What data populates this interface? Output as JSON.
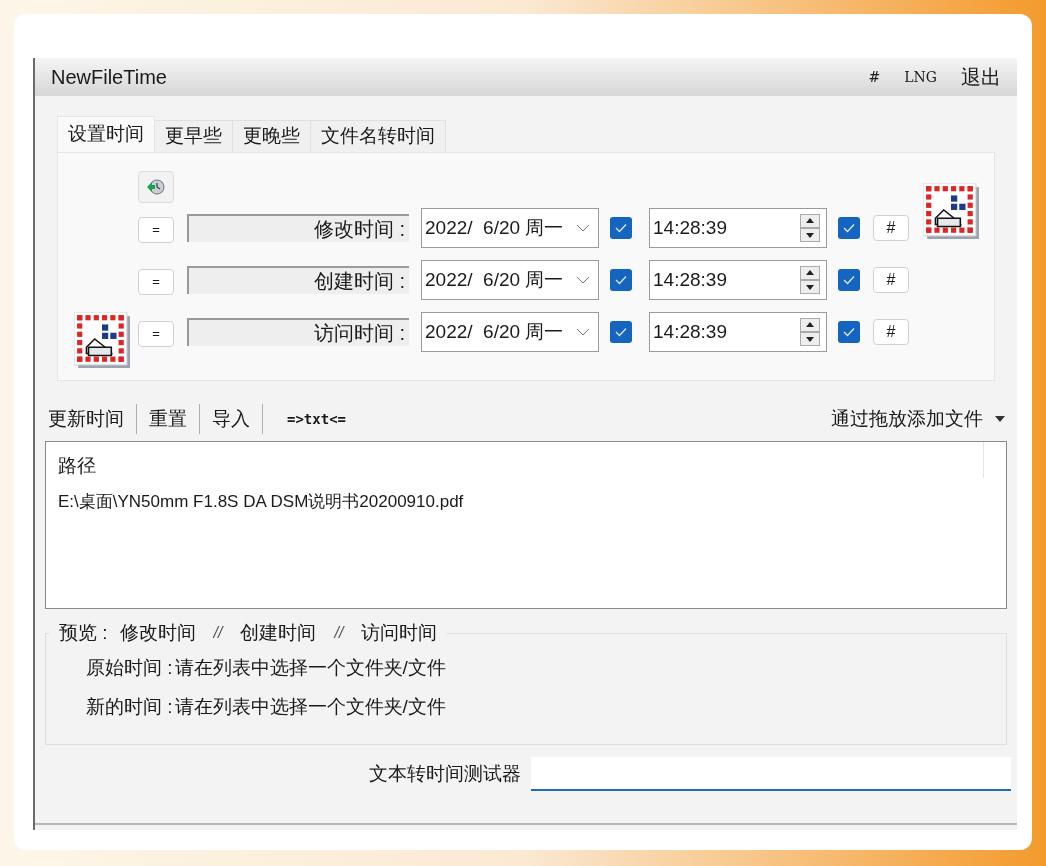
{
  "menu_bar": {
    "title": "NewFileTime",
    "items": [
      "#",
      "LNG",
      "退出"
    ]
  },
  "tabs": [
    {
      "label": "设置时间",
      "selected": true
    },
    {
      "label": "更早些",
      "selected": false
    },
    {
      "label": "更晚些",
      "selected": false
    },
    {
      "label": "文件名转时间",
      "selected": false
    }
  ],
  "time_rows": [
    {
      "equal_button": "=",
      "label": "修改时间 :",
      "date": "2022/  6/20 周一",
      "date_checked": true,
      "time": "14:28:39",
      "time_checked": true,
      "hash_button": "#"
    },
    {
      "equal_button": "=",
      "label": "创建时间 :",
      "date": "2022/  6/20 周一",
      "date_checked": true,
      "time": "14:28:39",
      "time_checked": true,
      "hash_button": "#"
    },
    {
      "equal_button": "=",
      "label": "访问时间 :",
      "date": "2022/  6/20 周一",
      "date_checked": true,
      "time": "14:28:39",
      "time_checked": true,
      "hash_button": "#"
    }
  ],
  "toolbar": {
    "items": [
      "更新时间",
      "重置",
      "导入",
      "=>txt<="
    ],
    "drop_menu": "通过拖放添加文件"
  },
  "file_list": {
    "column": "路径",
    "rows": [
      "E:\\桌面\\YN50mm F1.8S DA DSM说明书20200910.pdf"
    ]
  },
  "preview": {
    "legend": [
      "预览 :",
      "修改时间",
      "//",
      "创建时间",
      "//",
      "访问时间"
    ],
    "lines": [
      {
        "label": "原始时间 :",
        "value": "请在列表中选择一个文件夹/文件"
      },
      {
        "label": "新的时间 :",
        "value": "请在列表中选择一个文件夹/文件"
      }
    ]
  },
  "tester": {
    "label": "文本转时间测试器"
  }
}
